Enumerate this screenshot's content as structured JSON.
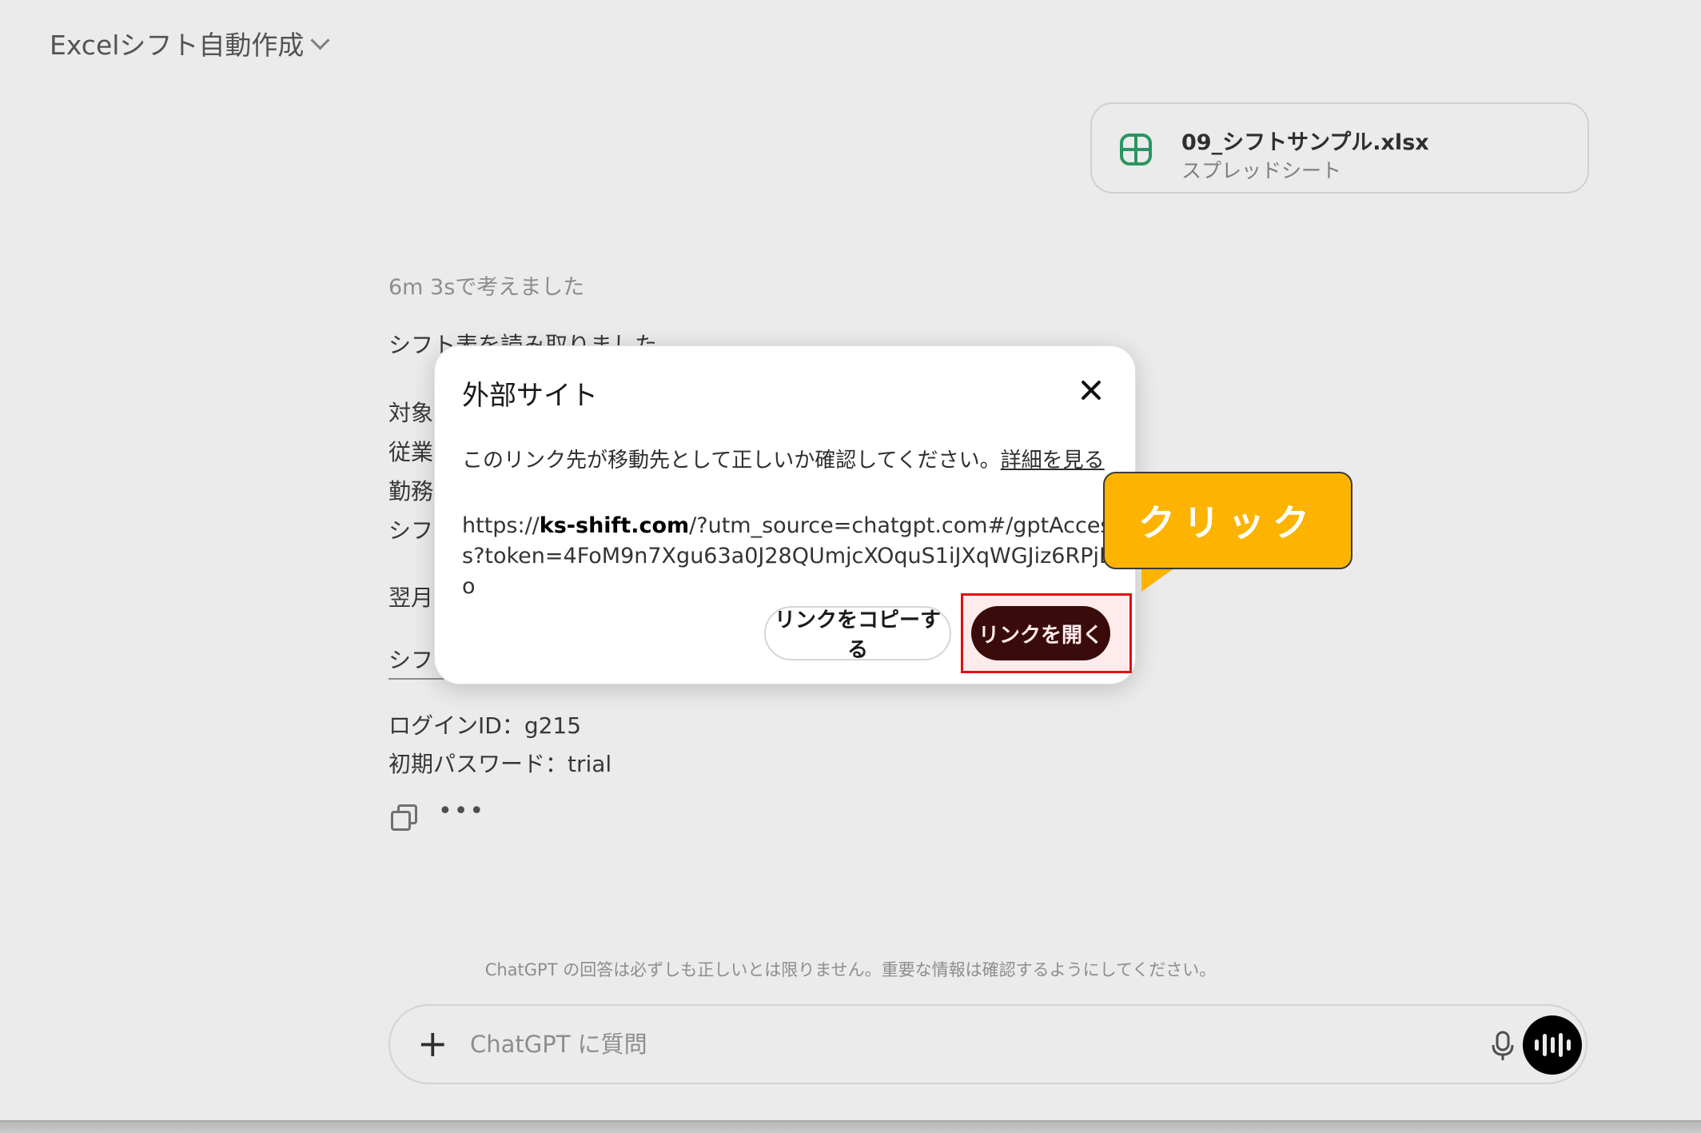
{
  "header": {
    "title": "Excelシフト自動作成"
  },
  "attachment": {
    "filename": "09_シフトサンプル.xlsx",
    "type": "スプレッドシート",
    "icon": "spreadsheet-icon",
    "icon_color": "#2ea36b"
  },
  "message": {
    "thought": "6m 3sで考えました",
    "lines": [
      "シフト表を読み取りました",
      "対象",
      "従業",
      "勤務",
      "シフト",
      "翌月",
      "シフト",
      "ログインID：g215",
      "初期パスワード：trial"
    ]
  },
  "composer": {
    "disclaimer": "ChatGPT の回答は必ずしも正しいとは限りません。重要な情報は確認するようにしてください。",
    "placeholder": "ChatGPT に質問"
  },
  "dialog": {
    "title": "外部サイト",
    "description": "このリンク先が移動先として正しいか確認してください。",
    "details_link": "詳細を見る",
    "url_prefix": "https://",
    "url_domain": "ks-shift.com",
    "url_rest": "/?utm_source=chatgpt.com#/gptAccess?token=4FoM9n7Xgu63a0J28QUmjcXOquS1iJXqWGJiz6RPjLo",
    "copy_button": "リンクをコピーする",
    "open_button": "リンクを開く",
    "open_button_color": "#2a0d0d"
  },
  "annotation": {
    "callout": "クリック",
    "callout_color": "#fcb400",
    "highlight_color": "#e01010"
  }
}
